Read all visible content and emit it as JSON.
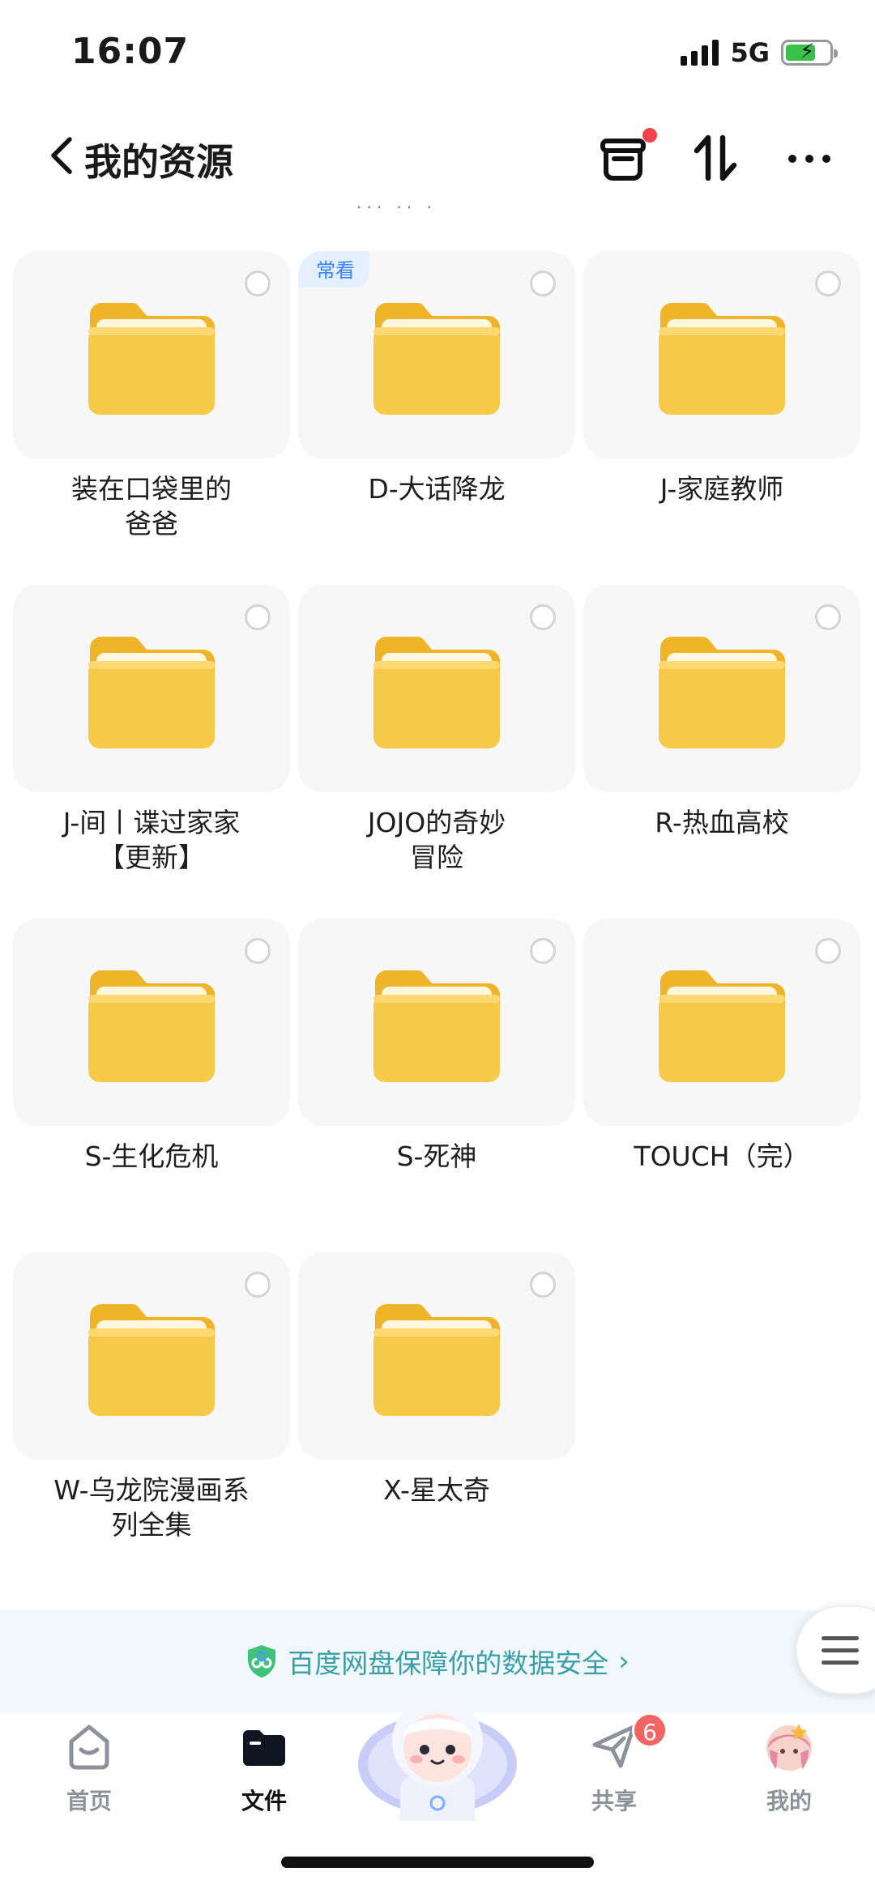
{
  "status_bar": {
    "time": "16:07",
    "network": "5G"
  },
  "header": {
    "title": "我的资源"
  },
  "badge_text": "常看",
  "folders": [
    {
      "name": "装在口袋里的\n爸爸",
      "badge": ""
    },
    {
      "name": "D-大话降龙",
      "badge": "常看"
    },
    {
      "name": "J-家庭教师",
      "badge": ""
    },
    {
      "name": "J-间丨谍过家家\n【更新】",
      "badge": ""
    },
    {
      "name": "JOJO的奇妙\n冒险",
      "badge": ""
    },
    {
      "name": "R-热血高校",
      "badge": ""
    },
    {
      "name": "S-生化危机",
      "badge": ""
    },
    {
      "name": "S-死神",
      "badge": ""
    },
    {
      "name": "TOUCH（完）",
      "badge": ""
    },
    {
      "name": "W-乌龙院漫画系\n列全集",
      "badge": ""
    },
    {
      "name": "X-星太奇",
      "badge": ""
    }
  ],
  "security_banner": {
    "text": "百度网盘保障你的数据安全"
  },
  "tabs": [
    {
      "label": "首页",
      "icon": "home-icon",
      "active": false
    },
    {
      "label": "文件",
      "icon": "folder-icon",
      "active": true
    },
    {
      "label": "共享",
      "icon": "share-plane-icon",
      "active": false
    },
    {
      "label": "我的",
      "icon": "avatar-icon",
      "active": false
    }
  ],
  "share_badge_count": "6",
  "colors": {
    "accent": "#3683f0",
    "folder_yellow": "#f7c948",
    "badge_red": "#f26464",
    "security_teal": "#3a9ea8"
  }
}
